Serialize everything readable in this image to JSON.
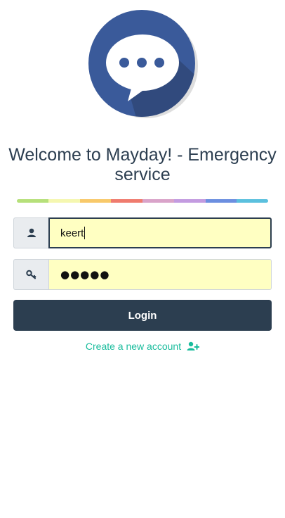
{
  "title": "Welcome to Mayday! - Emergency service",
  "logo": {
    "icon": "chat-bubble-icon",
    "colors": {
      "circle": "#3a5a9a",
      "shadow": "#2f4573",
      "bubble": "#ffffff"
    }
  },
  "rainbow_colors": [
    "#b6e07a",
    "#f5f7b0",
    "#f8c96a",
    "#ef7b6e",
    "#d9a3c9",
    "#c39be0",
    "#6c8fe0",
    "#5bc0de"
  ],
  "form": {
    "username": {
      "value": "keert",
      "icon": "user-icon"
    },
    "password": {
      "dots": "●●●●●",
      "icon": "key-icon"
    },
    "login_label": "Login",
    "create_account_label": "Create a new account",
    "create_account_icon": "add-user-icon"
  },
  "colors": {
    "primary": "#2c3e50",
    "link": "#18bc9c",
    "autofill": "#ffffc2"
  }
}
